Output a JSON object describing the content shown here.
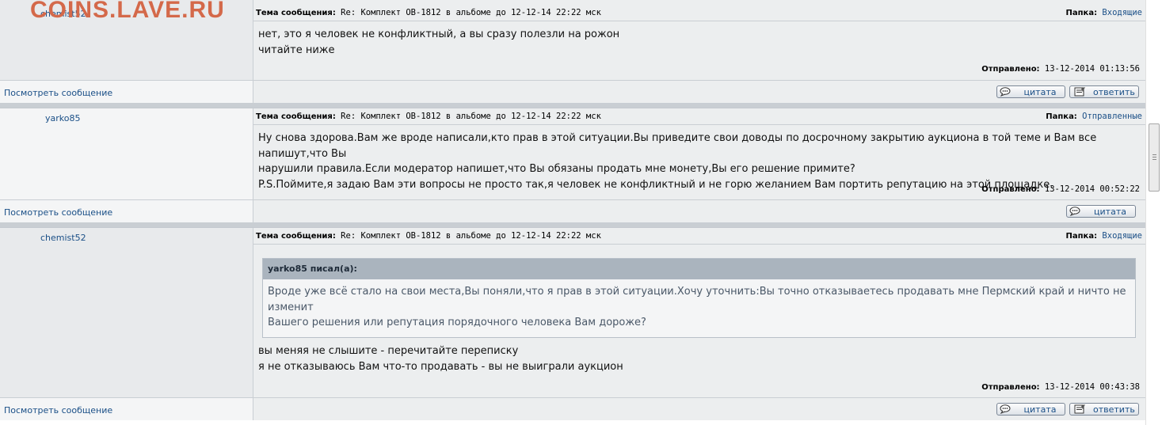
{
  "watermark": "COINS.LAVE.RU",
  "labels": {
    "subject": "Тема сообщения:",
    "folder": "Папка:",
    "sent": "Отправлено:",
    "view_message": "Посмотреть сообщение",
    "quote_button": "цитата",
    "reply_button": "ответить"
  },
  "posts": [
    {
      "author": "chemist52",
      "subject": "Re: Комплект ОВ-1812 в альбоме до 12-12-14 22:22 мск",
      "folder": "Входящие",
      "lines": [
        "нет, это я человек не конфликтный, а вы сразу полезли на рожон",
        "читайте ниже"
      ],
      "sent": "13-12-2014 01:13:56"
    },
    {
      "author": "yarko85",
      "subject": "Re: Комплект ОВ-1812 в альбоме до 12-12-14 22:22 мск",
      "folder": "Отправленные",
      "lines": [
        "Ну снова здорова.Вам же вроде написали,кто прав в этой ситуации.Вы приведите свои доводы по досрочному закрытию аукциона в той теме и Вам все напишут,что Вы",
        "нарушили правила.Если модератор напишет,что Вы обязаны продать мне монету,Вы его решение примите?",
        "P.S.Поймите,я задаю Вам эти вопросы не просто так,я человек не конфликтный и не горю желанием Вам портить репутацию на этой площадке."
      ],
      "sent": "13-12-2014 00:52:22"
    },
    {
      "author": "chemist52",
      "subject": "Re: Комплект ОВ-1812 в альбоме до 12-12-14 22:22 мск",
      "folder": "Входящие",
      "quote": {
        "author_line": "yarko85 писал(а):",
        "lines": [
          "Вроде уже всё стало на свои места,Вы поняли,что я прав в этой ситуации.Хочу уточнить:Вы точно отказываетесь продавать мне Пермский край и ничто не изменит",
          "Вашего решения или репутация порядочного человека Вам дороже?"
        ]
      },
      "lines": [
        "вы меняя не слышите - перечитайте переписку",
        "я не отказываюсь Вам что-то продавать - вы не выиграли аукцион"
      ],
      "sent": "13-12-2014 00:43:38"
    }
  ]
}
